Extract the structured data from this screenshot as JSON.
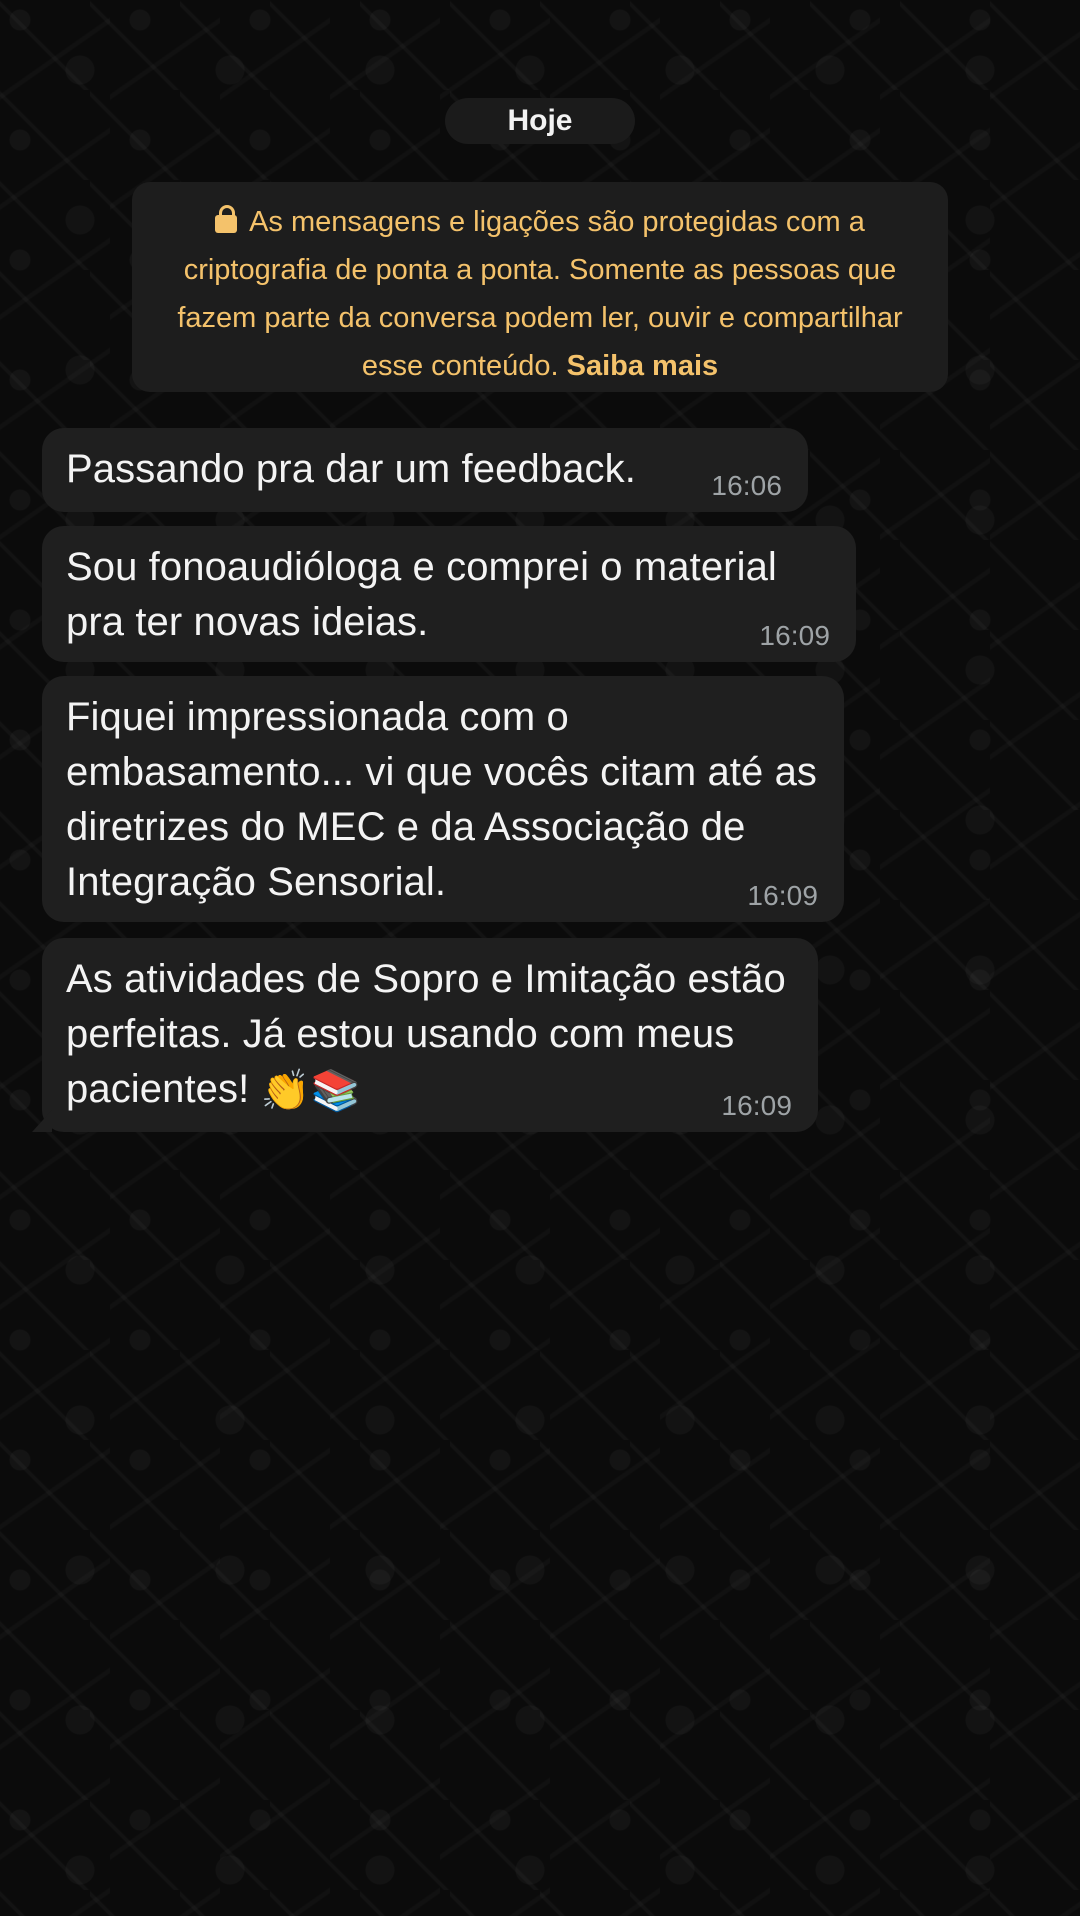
{
  "date_chip": {
    "label": "Hoje"
  },
  "encryption_notice": {
    "text": "As mensagens e ligações são protegidas com a criptografia de ponta a ponta. Somente as pessoas que fazem parte da conversa podem ler, ouvir e compartilhar esse conteúdo.",
    "learn_more": "Saiba mais",
    "icon": "lock-icon",
    "color": "#f4c26b"
  },
  "messages": [
    {
      "text": "Passando pra dar um feedback.",
      "time": "16:06"
    },
    {
      "text": "Sou fonoaudióloga e comprei o material pra ter novas ideias.",
      "time": "16:09"
    },
    {
      "text": "Fiquei impressionada com o embasamento... vi que vocês citam até as diretrizes do MEC e da Associação de Integração Sensorial.",
      "time": "16:09"
    },
    {
      "text": "As atividades de Sopro e Imitação estão perfeitas. Já estou usando com meus pacientes!",
      "emoji_1": "👏",
      "emoji_2": "📚",
      "time": "16:09"
    }
  ],
  "colors": {
    "background": "#0b0b0b",
    "bubble": "#1f1f1f",
    "timestamp": "#9ea3a6"
  }
}
